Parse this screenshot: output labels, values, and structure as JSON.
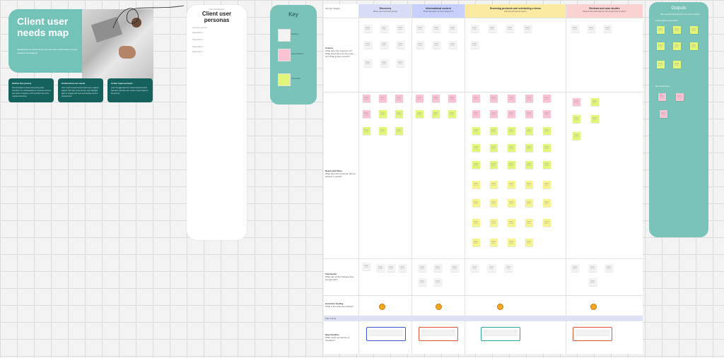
{
  "title_card": {
    "title": "Client user needs map",
    "description": "Visualisation of customer journey and user needs based on user research and analysis"
  },
  "info_cards": [
    {
      "heading": "Outline the journey",
      "body": "We formulated a broad user journey that describes our understanding of customer process and where it happens, who and when lies at its roughest decisions"
    },
    {
      "heading": "Understand user needs",
      "body": "User needs research points have been mapped against each part of the journey, then highlight gaps to engage with user and sending content development"
    },
    {
      "heading": "Action improvements",
      "body": "A list of suggestions for content improvements has been used the user needs of each stage of the journey"
    }
  ],
  "personas": {
    "small_label": "User Archetypes",
    "title": "Client user personas",
    "rows": [
      "Customer persona",
      "Stakeholder 1",
      "Stakeholder 2",
      "Stakeholder 3",
      "Stakeholder 4"
    ]
  },
  "key": {
    "title": "Key",
    "items": [
      {
        "label": "Evidence",
        "color": "#f3f3f3"
      },
      {
        "label": "Gaps identified",
        "color": "#fbc2d4"
      },
      {
        "label": "Assumption",
        "color": "#e2f77a"
      }
    ]
  },
  "board": {
    "journey_label": "Journey Stages",
    "stages": [
      {
        "title": "Discovery",
        "subtitle": "Where users start their journey",
        "color": "#d8dcf6"
      },
      {
        "title": "Informational content",
        "subtitle": "What information are they looking for?",
        "color": "#c6d0fb"
      },
      {
        "title": "Browsing products and scheduling a demo",
        "subtitle": "How can we help our users?",
        "color": "#fbeaa1"
      },
      {
        "title": "Reviews and case studies",
        "subtitle": "What do they think and how can we get them to return?",
        "color": "#fbd2d2"
      }
    ],
    "row_labels": [
      {
        "title": "Actions",
        "desc": "What does the customer do? What information do they look for? What is their context?"
      },
      {
        "title": "Needs and Pains",
        "desc": "What does the customer want to achieve or avoid?"
      },
      {
        "title": "Touchpoint",
        "desc": "What part of the business they interact with?"
      },
      {
        "title": "Customer Feeling",
        "desc": "What is the customer feeling?"
      },
      {
        "title": "Pain Points",
        "desc": ""
      },
      {
        "title": "Opportunities",
        "desc": "What could we improve or introduce?"
      }
    ],
    "opportunity_colors": [
      "#3b56d6",
      "#e4533a",
      "#2aa79b",
      "#e4533a"
    ]
  },
  "outputs": {
    "title": "Outputs",
    "subtitle": "Ideas and improvements from user needs analysis",
    "section1": "Content gaps recommended",
    "section2": "Site content items"
  }
}
